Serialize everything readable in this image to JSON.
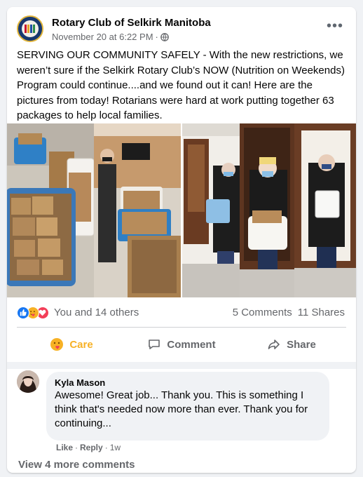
{
  "post": {
    "author": "Rotary Club of Selkirk Manitoba",
    "timestamp": "November 20 at 6:22 PM",
    "visibility_icon": "globe-icon",
    "more_label": "•••",
    "text": "SERVING OUR COMMUNITY SAFELY - With the new restrictions, we weren’t sure if the Selkirk Rotary Club’s NOW (Nutrition on Weekends) Program could continue....and we found out it can! Here are the pictures from today! Rotarians were hard at work putting together 63 packages to help local families."
  },
  "reactions": {
    "icons": [
      "like-icon",
      "care-icon",
      "love-icon"
    ],
    "summary": "You and 14 others",
    "comments_count": "5 Comments",
    "shares_count": "11 Shares"
  },
  "actions": {
    "care_label": "Care",
    "comment_label": "Comment",
    "share_label": "Share"
  },
  "comment": {
    "author": "Kyla Mason",
    "text": "Awesome! Great job... Thank you. This is something I think that's needed now more than ever. Thank you for continuing...",
    "like_label": "Like",
    "reply_label": "Reply",
    "age": "1w"
  },
  "view_more_label": "View 4 more comments",
  "colors": {
    "like_blue": "#1877f2",
    "care_yellow": "#f7b125",
    "love_red": "#f33e58",
    "secondary_text": "#65676b"
  }
}
